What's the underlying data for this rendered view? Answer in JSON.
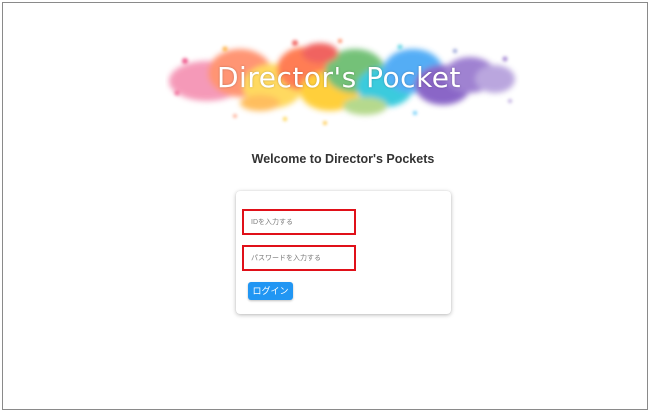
{
  "logo": {
    "text": "Director's Pocket"
  },
  "welcome": {
    "title": "Welcome to Director's Pockets"
  },
  "login_form": {
    "id_placeholder": "IDを入力する",
    "password_placeholder": "パスワードを入力する",
    "login_label": "ログイン"
  },
  "colors": {
    "login_button": "#2196f3",
    "highlight_border": "#e01019"
  }
}
